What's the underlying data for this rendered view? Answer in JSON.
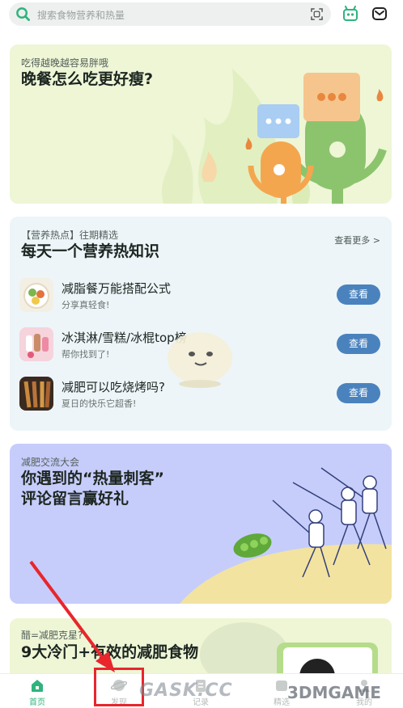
{
  "search": {
    "placeholder": "搜索食物营养和热量"
  },
  "icons": {
    "search": "search-icon",
    "scan": "scan-icon",
    "robot": "robot-icon",
    "mail": "mail-icon"
  },
  "colors": {
    "accent": "#2fb47d",
    "button": "#4a82bd",
    "annotation": "#e8262c"
  },
  "card1": {
    "kicker": "吃得越晚越容易胖哦",
    "headline": "晚餐怎么吃更好瘦?"
  },
  "card2": {
    "kicker": "【营养热点】往期精选",
    "headline": "每天一个营养热知识",
    "more": "查看更多 >",
    "items": [
      {
        "title": "减脂餐万能搭配公式",
        "subtitle": "分享真轻食!",
        "button": "查看"
      },
      {
        "title": "冰淇淋/雪糕/冰棍top榜",
        "subtitle": "帮你找到了!",
        "button": "查看"
      },
      {
        "title": "减肥可以吃烧烤吗?",
        "subtitle": "夏日的快乐它超香!",
        "button": "查看"
      }
    ]
  },
  "card3": {
    "kicker": "减肥交流大会",
    "headline1": "你遇到的“热量刺客”",
    "headline2": "评论留言赢好礼"
  },
  "card4": {
    "kicker": "醋=减肥克星?",
    "headline": "9大冷门+有效的减肥食物"
  },
  "nav": [
    {
      "label": "首页",
      "active": true
    },
    {
      "label": "发现",
      "active": false
    },
    {
      "label": "记录",
      "active": false
    },
    {
      "label": "精选",
      "active": false
    },
    {
      "label": "我的",
      "active": false
    }
  ],
  "watermark": {
    "text1": "GASK.CC",
    "text2": "3DMGAME"
  }
}
